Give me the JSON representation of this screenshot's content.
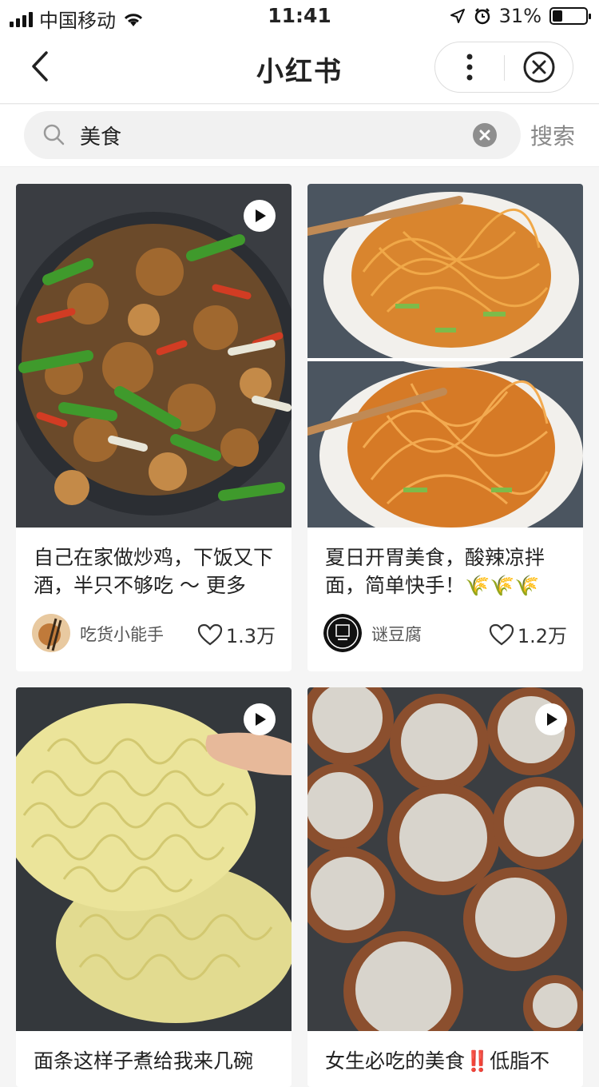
{
  "status": {
    "carrier": "中国移动",
    "time": "11:41",
    "battery": "31%",
    "battery_level": 0.31
  },
  "nav": {
    "title": "小红书",
    "icons": [
      "back-chevron-icon",
      "more-dots-icon",
      "close-circle-icon"
    ]
  },
  "search": {
    "query": "美食",
    "button": "搜索",
    "icons": [
      "search-icon",
      "clear-icon"
    ]
  },
  "cards": [
    {
      "title": "自己在家做炒鸡，下饭又下酒，半只不够吃 ～ 更多",
      "author": "吃货小能手",
      "likes": "1.3万",
      "video": true
    },
    {
      "title": "夏日开胃美食，酸辣凉拌面，简单快手！🌾🌾🌾",
      "author": "谜豆腐",
      "likes": "1.2万",
      "video": false
    },
    {
      "title": "面条这样子煮给我来几碗",
      "author": "",
      "likes": "",
      "video": true
    },
    {
      "title": "女生必吃的美食‼️低脂不",
      "author": "",
      "likes": "",
      "video": true
    }
  ],
  "colors": {
    "background": "#f5f5f5",
    "card": "#ffffff",
    "text": "#222222",
    "muted": "#888888"
  }
}
